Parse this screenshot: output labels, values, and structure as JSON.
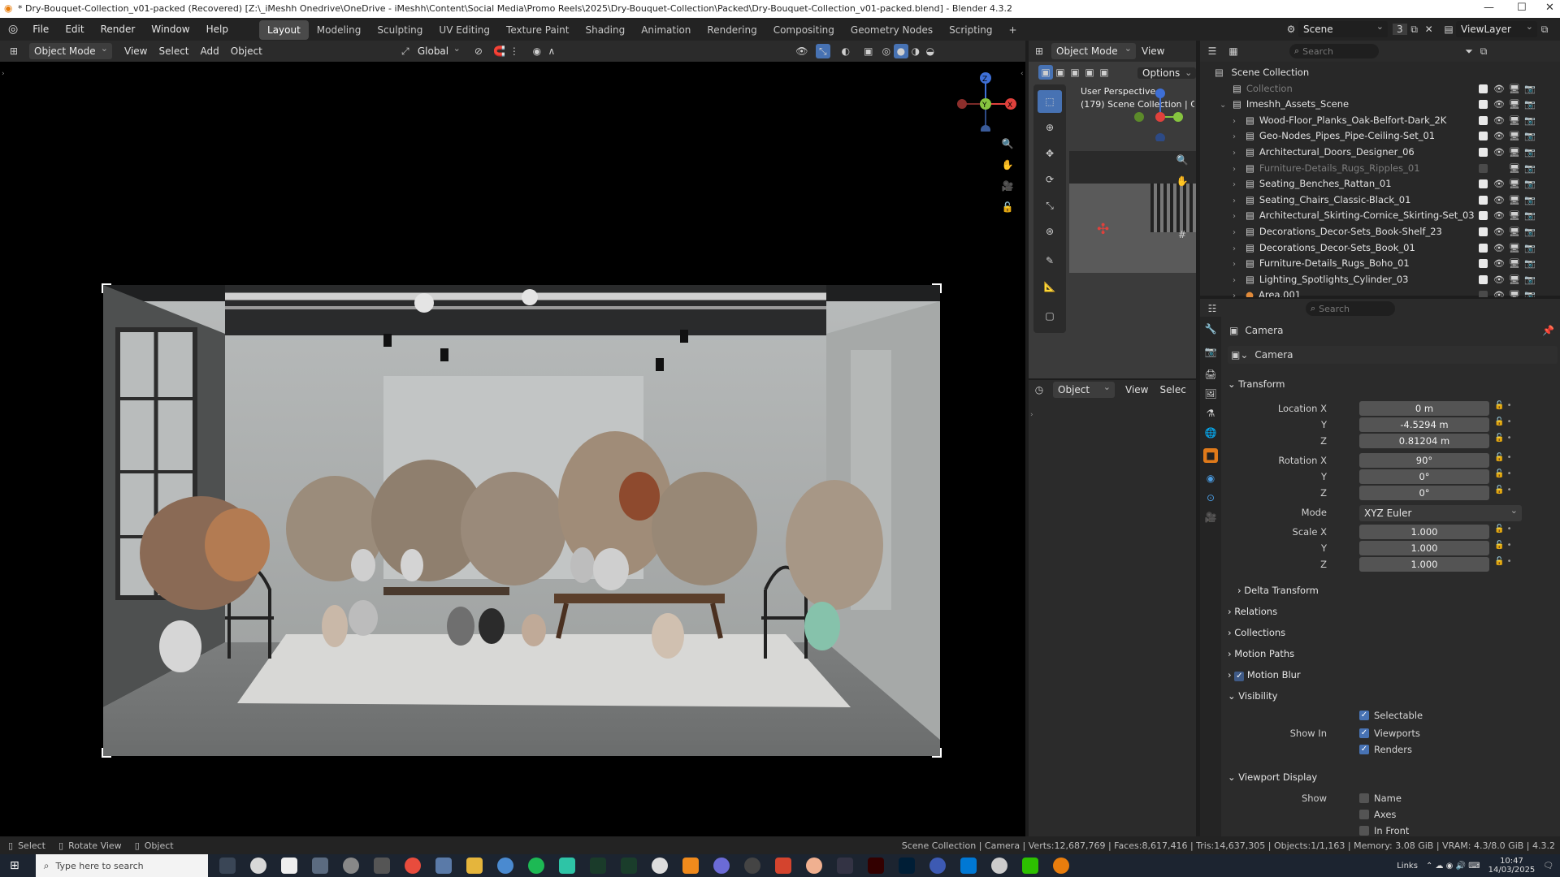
{
  "window": {
    "title": "* Dry-Bouquet-Collection_v01-packed (Recovered) [Z:\\_iMeshh Onedrive\\OneDrive - iMeshh\\Content\\Social Media\\Promo Reels\\2025\\Dry-Bouquet-Collection\\Packed\\Dry-Bouquet-Collection_v01-packed.blend] - Blender 4.3.2"
  },
  "menu": [
    "File",
    "Edit",
    "Render",
    "Window",
    "Help"
  ],
  "workspaces": [
    "Layout",
    "Modeling",
    "Sculpting",
    "UV Editing",
    "Texture Paint",
    "Shading",
    "Animation",
    "Rendering",
    "Compositing",
    "Geometry Nodes",
    "Scripting"
  ],
  "scene": {
    "name": "Scene",
    "count": "3",
    "view_layer": "ViewLayer"
  },
  "viewport_header": {
    "mode": "Object Mode",
    "menus": [
      "View",
      "Select",
      "Add",
      "Object"
    ],
    "orientation": "Global"
  },
  "mini_view": {
    "mode": "Object Mode",
    "view_menu": "View",
    "options": "Options",
    "overlay_line1": "User Perspective",
    "overlay_line2": "(179) Scene Collection | Ca",
    "bottom_mode": "Object",
    "bottom_view": "View",
    "bottom_select": "Selec"
  },
  "outliner": {
    "search_placeholder": "Search",
    "root": "Scene Collection",
    "rows": [
      {
        "name": "Collection",
        "dim": true,
        "level": 1,
        "checked": true
      },
      {
        "name": "Imeshh_Assets_Scene",
        "dim": false,
        "level": 1,
        "checked": true
      },
      {
        "name": "Wood-Floor_Planks_Oak-Belfort-Dark_2K",
        "dim": false,
        "level": 2,
        "checked": true
      },
      {
        "name": "Geo-Nodes_Pipes_Pipe-Ceiling-Set_01",
        "dim": false,
        "level": 2,
        "checked": true
      },
      {
        "name": "Architectural_Doors_Designer_06",
        "dim": false,
        "level": 2,
        "checked": true
      },
      {
        "name": "Furniture-Details_Rugs_Ripples_01",
        "dim": true,
        "level": 2,
        "checked": false
      },
      {
        "name": "Seating_Benches_Rattan_01",
        "dim": false,
        "level": 2,
        "checked": true
      },
      {
        "name": "Seating_Chairs_Classic-Black_01",
        "dim": false,
        "level": 2,
        "checked": true
      },
      {
        "name": "Architectural_Skirting-Cornice_Skirting-Set_03",
        "dim": false,
        "level": 2,
        "checked": true
      },
      {
        "name": "Decorations_Decor-Sets_Book-Shelf_23",
        "dim": false,
        "level": 2,
        "checked": true
      },
      {
        "name": "Decorations_Decor-Sets_Book_01",
        "dim": false,
        "level": 2,
        "checked": true
      },
      {
        "name": "Furniture-Details_Rugs_Boho_01",
        "dim": false,
        "level": 2,
        "checked": true
      },
      {
        "name": "Lighting_Spotlights_Cylinder_03",
        "dim": false,
        "level": 2,
        "checked": true
      },
      {
        "name": "Area.001",
        "dim": false,
        "level": 2,
        "checked": false
      }
    ]
  },
  "properties": {
    "search_placeholder": "Search",
    "object_name": "Camera",
    "data_name": "Camera",
    "transform_label": "Transform",
    "location_label": "Location X",
    "rotation_label": "Rotation X",
    "scale_label": "Scale X",
    "y_label": "Y",
    "z_label": "Z",
    "location": [
      "0 m",
      "-4.5294 m",
      "0.81204 m"
    ],
    "rotation": [
      "90°",
      "0°",
      "0°"
    ],
    "mode_label": "Mode",
    "mode_value": "XYZ Euler",
    "scale": [
      "1.000",
      "1.000",
      "1.000"
    ],
    "panels": [
      "Delta Transform",
      "Relations",
      "Collections",
      "Motion Paths",
      "Motion Blur"
    ],
    "visibility_label": "Visibility",
    "selectable_label": "Selectable",
    "show_in_label": "Show In",
    "viewports_label": "Viewports",
    "renders_label": "Renders",
    "viewport_display_label": "Viewport Display",
    "show_label": "Show",
    "name_label": "Name",
    "axes_label": "Axes",
    "in_front_label": "In Front"
  },
  "status": {
    "select": "Select",
    "rotate": "Rotate View",
    "object": "Object",
    "stats": "Scene Collection | Camera | Verts:12,687,769 | Faces:8,617,416 | Tris:14,637,305 | Objects:1/1,163 | Memory: 3.08 GiB | VRAM: 4.3/8.0 GiB | 4.3.2"
  },
  "taskbar": {
    "search_placeholder": "Type here to search",
    "links": "Links",
    "time": "10:47",
    "date": "14/03/2025"
  },
  "colors": {
    "accent": "#4772b3",
    "axis_x": "#e0413c",
    "axis_y": "#86c43f",
    "axis_z": "#3e6fd6"
  }
}
